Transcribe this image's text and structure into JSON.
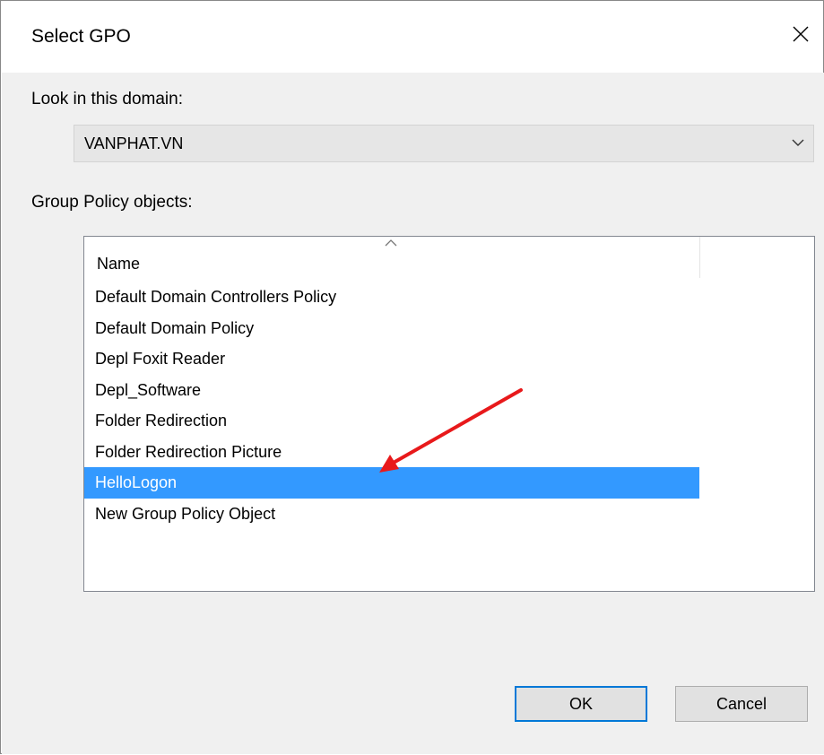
{
  "window": {
    "title": "Select GPO",
    "close_icon": "close-icon"
  },
  "domain_section": {
    "label": "Look in this domain:",
    "selected_domain": "VANPHAT.VN",
    "dropdown_icon": "chevron-down-icon"
  },
  "gpo_section": {
    "label": "Group Policy objects:",
    "column_header": "Name",
    "sort_icon": "sort-ascending-icon",
    "items": [
      {
        "label": "Default Domain Controllers Policy",
        "selected": false
      },
      {
        "label": "Default Domain Policy",
        "selected": false
      },
      {
        "label": "Depl Foxit Reader",
        "selected": false
      },
      {
        "label": "Depl_Software",
        "selected": false
      },
      {
        "label": "Folder Redirection",
        "selected": false
      },
      {
        "label": "Folder Redirection Picture",
        "selected": false
      },
      {
        "label": "HelloLogon",
        "selected": true
      },
      {
        "label": "New Group Policy Object",
        "selected": false
      }
    ]
  },
  "buttons": {
    "ok_label": "OK",
    "cancel_label": "Cancel"
  },
  "colors": {
    "selection": "#3399ff",
    "focus_border": "#0078d7",
    "annotation_arrow": "#e8191b"
  },
  "annotation": {
    "icon": "red-arrow-icon"
  }
}
